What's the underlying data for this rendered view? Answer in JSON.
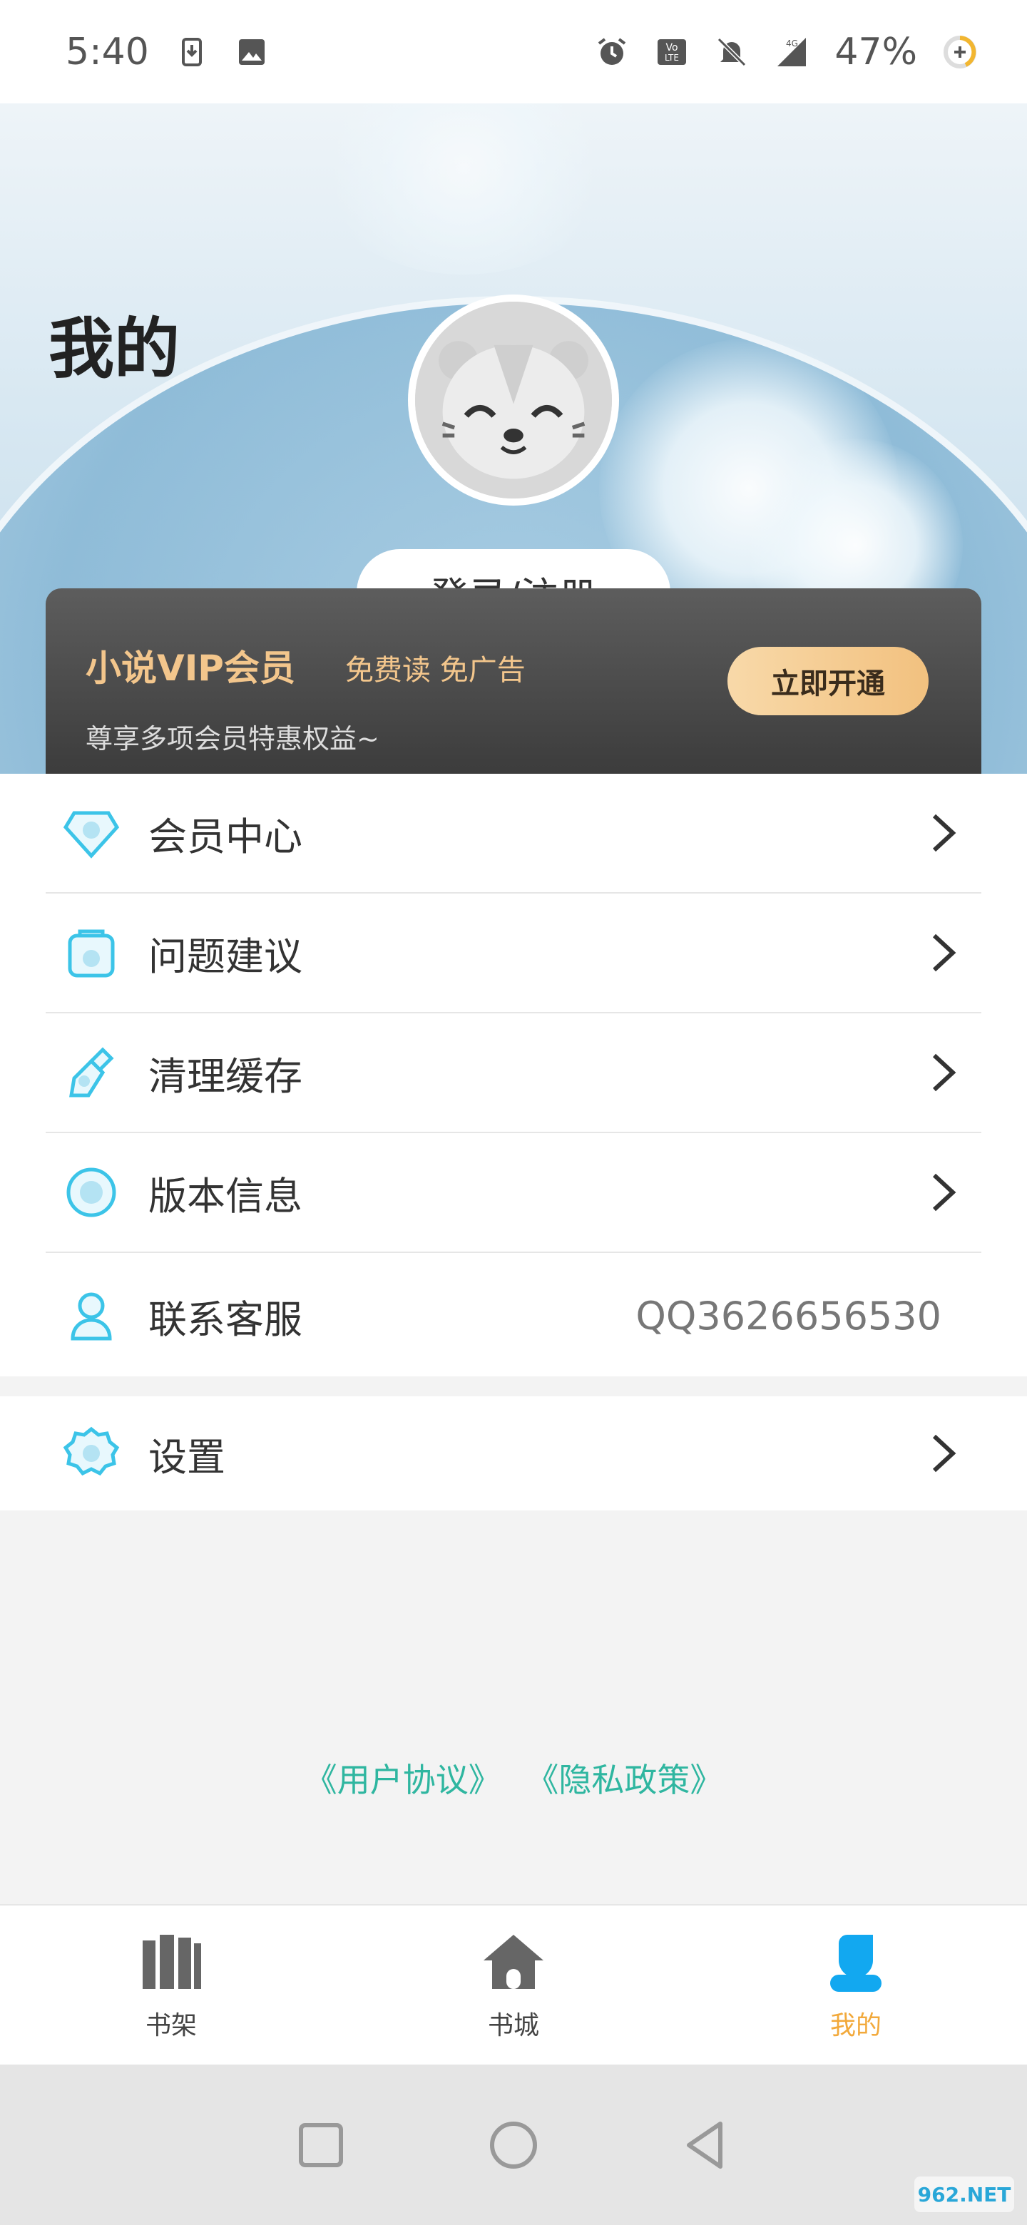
{
  "status_bar": {
    "time": "5:40",
    "battery_percent": "47%",
    "network": "4G",
    "icons": [
      "download-icon",
      "image-icon",
      "alarm-icon",
      "volte-icon",
      "mute-bell-icon",
      "signal-icon",
      "battery-icon"
    ]
  },
  "header": {
    "title": "我的",
    "login_label": "登录/注册"
  },
  "vip": {
    "title": "小说VIP会员",
    "tagline": "免费读 免广告",
    "subtitle": "尊享多项会员特惠权益~",
    "button_label": "立即开通"
  },
  "menu": {
    "items": [
      {
        "label": "会员中心",
        "icon": "diamond-icon"
      },
      {
        "label": "问题建议",
        "icon": "feedback-icon"
      },
      {
        "label": "清理缓存",
        "icon": "brush-icon"
      },
      {
        "label": "版本信息",
        "icon": "info-circle-icon"
      },
      {
        "label": "联系客服",
        "icon": "user-icon",
        "value": "QQ3626656530"
      }
    ],
    "settings_label": "设置"
  },
  "links": {
    "user_agreement": "《用户协议》",
    "privacy_policy": "《隐私政策》"
  },
  "bottom_nav": {
    "items": [
      {
        "label": "书架",
        "icon": "bookshelf-icon"
      },
      {
        "label": "书城",
        "icon": "home-icon"
      },
      {
        "label": "我的",
        "icon": "profile-icon",
        "active": true
      }
    ]
  },
  "colors": {
    "accent": "#f2a93b",
    "vip_gold": "#f3c68c",
    "icon_cyan": "#3cc4e8",
    "link_green": "#2fb6a0"
  },
  "watermark": "962.NET"
}
